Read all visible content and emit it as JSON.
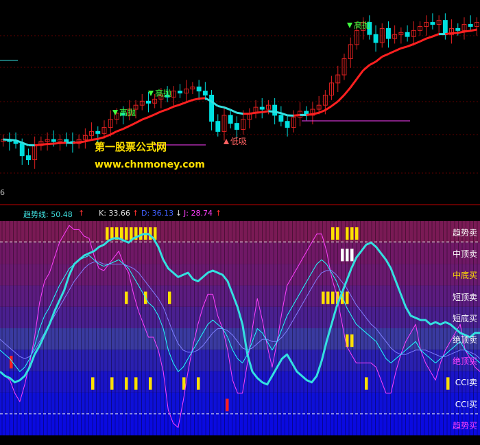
{
  "watermark": {
    "name": "第一股票公式网",
    "url": "www.chnmoney.com"
  },
  "axis_number": "6",
  "indicator_header": {
    "trend_label": "趋势线: 50.48",
    "k_label": "K: 33.66",
    "d_label": "D: 36.13",
    "j_label": "J: 28.74",
    "up_arrow": "↑",
    "down_arrow": "↓"
  },
  "colors": {
    "candle_up": "#e02020",
    "candle_down": "#00e0e0",
    "trend_line_red": "#ff2020",
    "trend_line_cyan": "#33e0e0",
    "kdj_k": "#20ffff",
    "kdj_d": "#8080ff",
    "kdj_j": "#ff40ff",
    "signal_yellow": "#ffe000",
    "signal_white": "#ffffff",
    "signal_red": "#ff2020"
  },
  "chart_data": [
    {
      "type": "candlestick",
      "annotations": [
        {
          "text": "高抛",
          "color": "#40ff40",
          "arrow": "down"
        },
        {
          "text": "高抛",
          "color": "#40ff40",
          "arrow": "down"
        },
        {
          "text": "低吸",
          "color": "#ff6060",
          "arrow": "up"
        },
        {
          "text": "高抛",
          "color": "#40ff40",
          "arrow": "down"
        }
      ],
      "close": [
        38,
        37,
        36,
        30,
        28,
        35,
        37,
        38,
        37,
        38,
        37,
        36,
        38,
        40,
        42,
        41,
        44,
        48,
        51,
        50,
        53,
        55,
        57,
        56,
        58,
        60,
        59,
        62,
        61,
        63,
        64,
        62,
        60,
        47,
        42,
        50,
        46,
        43,
        48,
        51,
        54,
        53,
        55,
        50,
        47,
        44,
        49,
        52,
        50,
        53,
        55,
        60,
        66,
        70,
        78,
        85,
        92,
        96,
        90,
        86,
        93,
        88,
        90,
        91,
        89,
        92,
        94,
        96,
        95,
        97,
        90,
        93,
        92,
        95,
        94,
        96
      ]
    },
    {
      "type": "signal-bands",
      "bands": [
        {
          "label": "趋势卖",
          "label_color": "#ffffff",
          "fill": "#7a1a55"
        },
        {
          "label": "中顶卖",
          "label_color": "#ffffff",
          "fill": "#701866"
        },
        {
          "label": "中底买",
          "label_color": "#ffe000",
          "fill": "#6a1a70"
        },
        {
          "label": "短顶卖",
          "label_color": "#ffffff",
          "fill": "#5c1c80"
        },
        {
          "label": "短底买",
          "label_color": "#ffffff",
          "fill": "#4a2090"
        },
        {
          "label": "绝顶卖",
          "label_color": "#ffffff",
          "fill": "#3a3aa0"
        },
        {
          "label": "绝顶买",
          "label_color": "#ff40ff",
          "fill": "#2a20b0"
        },
        {
          "label": "CCI卖",
          "label_color": "#ffffff",
          "fill": "#1a14c8"
        },
        {
          "label": "CCI买",
          "label_color": "#ffffff",
          "fill": "#0e10d8"
        },
        {
          "label": "趋势买",
          "label_color": "#ff40ff",
          "fill": "#0a0ae0"
        }
      ],
      "signals": [
        {
          "band": 0,
          "color": "#ffe000",
          "positions": [
            22,
            23,
            24,
            25,
            26,
            27,
            28,
            29,
            30,
            31,
            32,
            69,
            70,
            72,
            73,
            74
          ]
        },
        {
          "band": 1,
          "color": "#ffffff",
          "positions": [
            71,
            72,
            73
          ]
        },
        {
          "band": 3,
          "color": "#ffe000",
          "positions": [
            26,
            30,
            35,
            67,
            68,
            69,
            70,
            71,
            72
          ]
        },
        {
          "band": 5,
          "color": "#ffe000",
          "positions": [
            72,
            73
          ]
        },
        {
          "band": 6,
          "color": "#ff2020",
          "positions": [
            2
          ]
        },
        {
          "band": 7,
          "color": "#ffe000",
          "positions": [
            19,
            23,
            26,
            28,
            31,
            38,
            41,
            76,
            93
          ]
        },
        {
          "band": 8,
          "color": "#ff2020",
          "positions": [
            47
          ]
        }
      ],
      "trend_line": [
        30,
        28,
        27,
        25,
        26,
        28,
        32,
        38,
        42,
        47,
        52,
        58,
        63,
        68,
        75,
        80,
        82,
        84,
        85,
        86,
        88,
        89,
        91,
        92,
        92,
        91,
        90,
        92,
        93,
        94,
        94,
        92,
        88,
        82,
        78,
        76,
        74,
        75,
        76,
        73,
        72,
        74,
        76,
        77,
        76,
        75,
        72,
        66,
        60,
        52,
        38,
        30,
        27,
        25,
        24,
        28,
        32,
        36,
        38,
        34,
        30,
        28,
        26,
        25,
        28,
        35,
        44,
        52,
        60,
        66,
        72,
        78,
        83,
        86,
        89,
        90,
        88,
        85,
        82,
        78,
        72,
        66,
        60,
        56,
        55,
        54,
        54,
        52,
        53,
        52,
        53,
        52,
        50,
        48,
        47,
        46,
        48,
        48
      ],
      "k": [
        40,
        38,
        36,
        33,
        30,
        32,
        36,
        42,
        50,
        56,
        60,
        65,
        70,
        74,
        78,
        80,
        82,
        83,
        84,
        82,
        80,
        79,
        80,
        81,
        82,
        80,
        78,
        74,
        70,
        66,
        62,
        60,
        56,
        50,
        40,
        34,
        30,
        32,
        36,
        40,
        44,
        48,
        52,
        54,
        52,
        50,
        46,
        40,
        36,
        34,
        38,
        44,
        50,
        48,
        44,
        40,
        44,
        50,
        56,
        60,
        64,
        68,
        72,
        76,
        80,
        82,
        80,
        76,
        72,
        66,
        60,
        56,
        52,
        50,
        48,
        46,
        44,
        40,
        36,
        34,
        36,
        38,
        40,
        42,
        44,
        40,
        38,
        36,
        34,
        36,
        38,
        40,
        42,
        44,
        40,
        38,
        36,
        34
      ],
      "d": [
        45,
        43,
        41,
        39,
        37,
        36,
        37,
        40,
        44,
        48,
        52,
        56,
        60,
        64,
        68,
        72,
        75,
        78,
        80,
        81,
        81,
        80,
        80,
        80,
        80,
        80,
        79,
        78,
        76,
        73,
        70,
        67,
        64,
        60,
        54,
        48,
        43,
        40,
        39,
        39,
        40,
        42,
        45,
        48,
        50,
        50,
        49,
        47,
        44,
        41,
        40,
        41,
        43,
        45,
        45,
        44,
        44,
        46,
        49,
        53,
        57,
        61,
        65,
        69,
        73,
        76,
        77,
        77,
        75,
        72,
        69,
        65,
        61,
        58,
        55,
        52,
        50,
        47,
        44,
        41,
        39,
        38,
        38,
        39,
        40,
        40,
        40,
        39,
        38,
        37,
        37,
        38,
        39,
        40,
        40,
        39,
        38,
        36
      ],
      "j": [
        30,
        28,
        26,
        20,
        16,
        24,
        34,
        46,
        62,
        72,
        76,
        83,
        90,
        94,
        98,
        96,
        96,
        93,
        92,
        84,
        78,
        77,
        80,
        83,
        86,
        80,
        76,
        66,
        58,
        52,
        46,
        46,
        40,
        30,
        12,
        6,
        4,
        16,
        30,
        42,
        52,
        60,
        66,
        66,
        56,
        50,
        40,
        26,
        20,
        20,
        34,
        50,
        64,
        54,
        42,
        32,
        44,
        58,
        70,
        74,
        78,
        82,
        86,
        90,
        94,
        94,
        86,
        74,
        66,
        54,
        42,
        38,
        34,
        34,
        34,
        34,
        32,
        26,
        20,
        20,
        30,
        38,
        44,
        48,
        52,
        40,
        34,
        30,
        26,
        34,
        40,
        44,
        48,
        52,
        40,
        36,
        32,
        30
      ]
    }
  ]
}
